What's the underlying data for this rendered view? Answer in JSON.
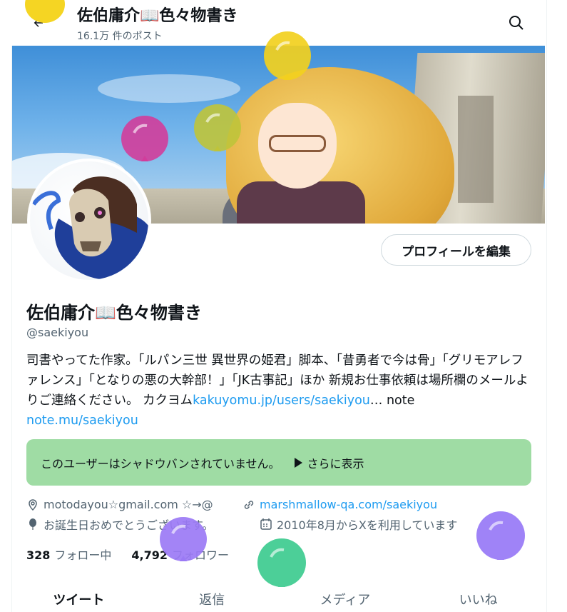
{
  "header": {
    "display_name": "佐伯庸介📖色々物書き",
    "post_count": "16.1万 件のポスト"
  },
  "profile": {
    "edit_button": "プロフィールを編集",
    "display_name": "佐伯庸介📖色々物書き",
    "handle": "@saekiyou",
    "bio_text": "司書やってた作家。「ルパン三世 異世界の姫君」脚本、「昔勇者で今は骨」「グリモアレファレンス」「となりの悪の大幹部！」「JK古事記」ほか 新規お仕事依頼は場所欄のメールよりご連絡ください。 カクヨム",
    "bio_link1": "kakuyomu.jp/users/saekiyou",
    "bio_mid": "… note ",
    "bio_link2": "note.mu/saekiyou",
    "location": "motodayou☆gmail.com ☆→@",
    "website": "marshmallow-qa.com/saekiyou",
    "birthday": "お誕生日おめでとうございます。",
    "joined": "2010年8月からXを利用しています"
  },
  "shadowban": {
    "text": "このユーザーはシャドウバンされていません。",
    "more": "さらに表示"
  },
  "stats": {
    "following_count": "328",
    "following_label": "フォロー中",
    "followers_count": "4,792",
    "followers_label": "フォロワー"
  },
  "tabs": [
    "ツイート",
    "返信",
    "メディア",
    "いいね"
  ],
  "colors": {
    "link": "#1d9bf0",
    "notice_bg": "#9fdca4",
    "balloons": [
      "#f5d523",
      "#f2d01e",
      "#d23d9b",
      "#bfc43a",
      "#9b7af5",
      "#4ccf98",
      "#9f83f7"
    ]
  }
}
